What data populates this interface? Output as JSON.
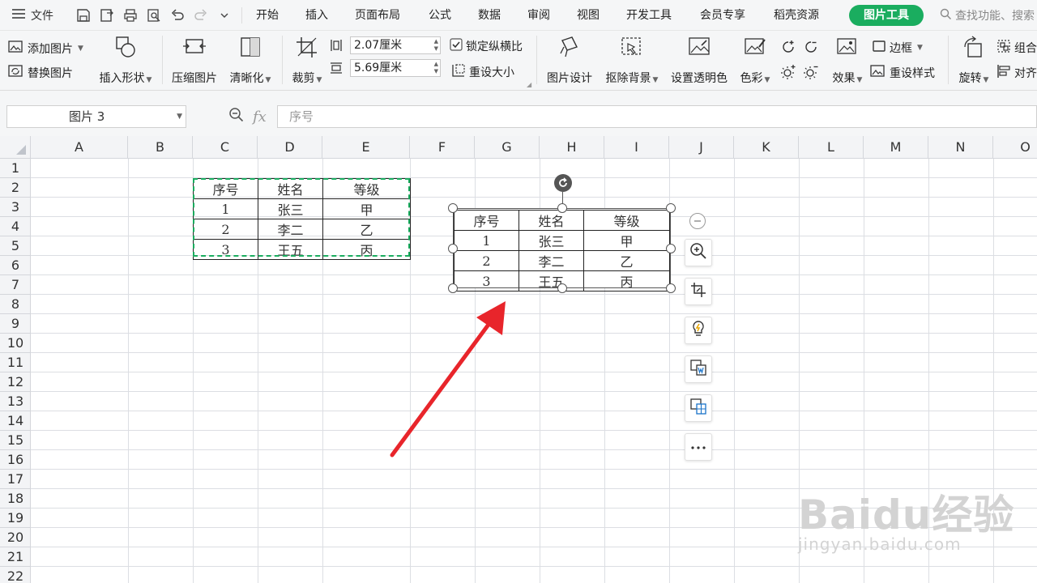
{
  "menubar": {
    "file_label": "文件",
    "tabs": [
      "开始",
      "插入",
      "页面布局",
      "公式",
      "数据",
      "审阅",
      "视图",
      "开发工具",
      "会员专享",
      "稻壳资源"
    ],
    "active_tab": "图片工具",
    "search_text": "查找功能、搜索"
  },
  "ribbon": {
    "add_picture": "添加图片",
    "replace_picture": "替换图片",
    "insert_shape": "插入形状",
    "compress_picture": "压缩图片",
    "sharpen": "清晰化",
    "crop": "裁剪",
    "height_value": "2.07厘米",
    "width_value": "5.69厘米",
    "lock_ratio": "锁定纵横比",
    "reset_size": "重设大小",
    "picture_design": "图片设计",
    "remove_background": "抠除背景",
    "set_transparent": "设置透明色",
    "color": "色彩",
    "effects": "效果",
    "border": "边框",
    "reset_style": "重设样式",
    "rotate": "旋转",
    "group": "组合",
    "align": "对齐"
  },
  "formulabar": {
    "name_box": "图片 3",
    "fx": "fx",
    "formula": "序号"
  },
  "grid": {
    "columns": [
      "A",
      "B",
      "C",
      "D",
      "E",
      "F",
      "G",
      "H",
      "I",
      "J",
      "K",
      "L",
      "M",
      "N",
      "O"
    ],
    "rows": [
      "1",
      "2",
      "3",
      "4",
      "5",
      "6",
      "7",
      "8",
      "9",
      "10",
      "11",
      "12",
      "13",
      "14",
      "15",
      "16",
      "17",
      "18",
      "19",
      "20",
      "21",
      "22"
    ]
  },
  "table": {
    "headers": [
      "序号",
      "姓名",
      "等级"
    ],
    "rows": [
      [
        "1",
        "张三",
        "甲"
      ],
      [
        "2",
        "李二",
        "乙"
      ],
      [
        "3",
        "王五",
        "丙"
      ]
    ]
  },
  "watermark": {
    "logo": "Baidu经验",
    "url": "jingyan.baidu.com"
  },
  "colors": {
    "accent_green": "#1aad5f",
    "arrow_red": "#e8252b"
  }
}
